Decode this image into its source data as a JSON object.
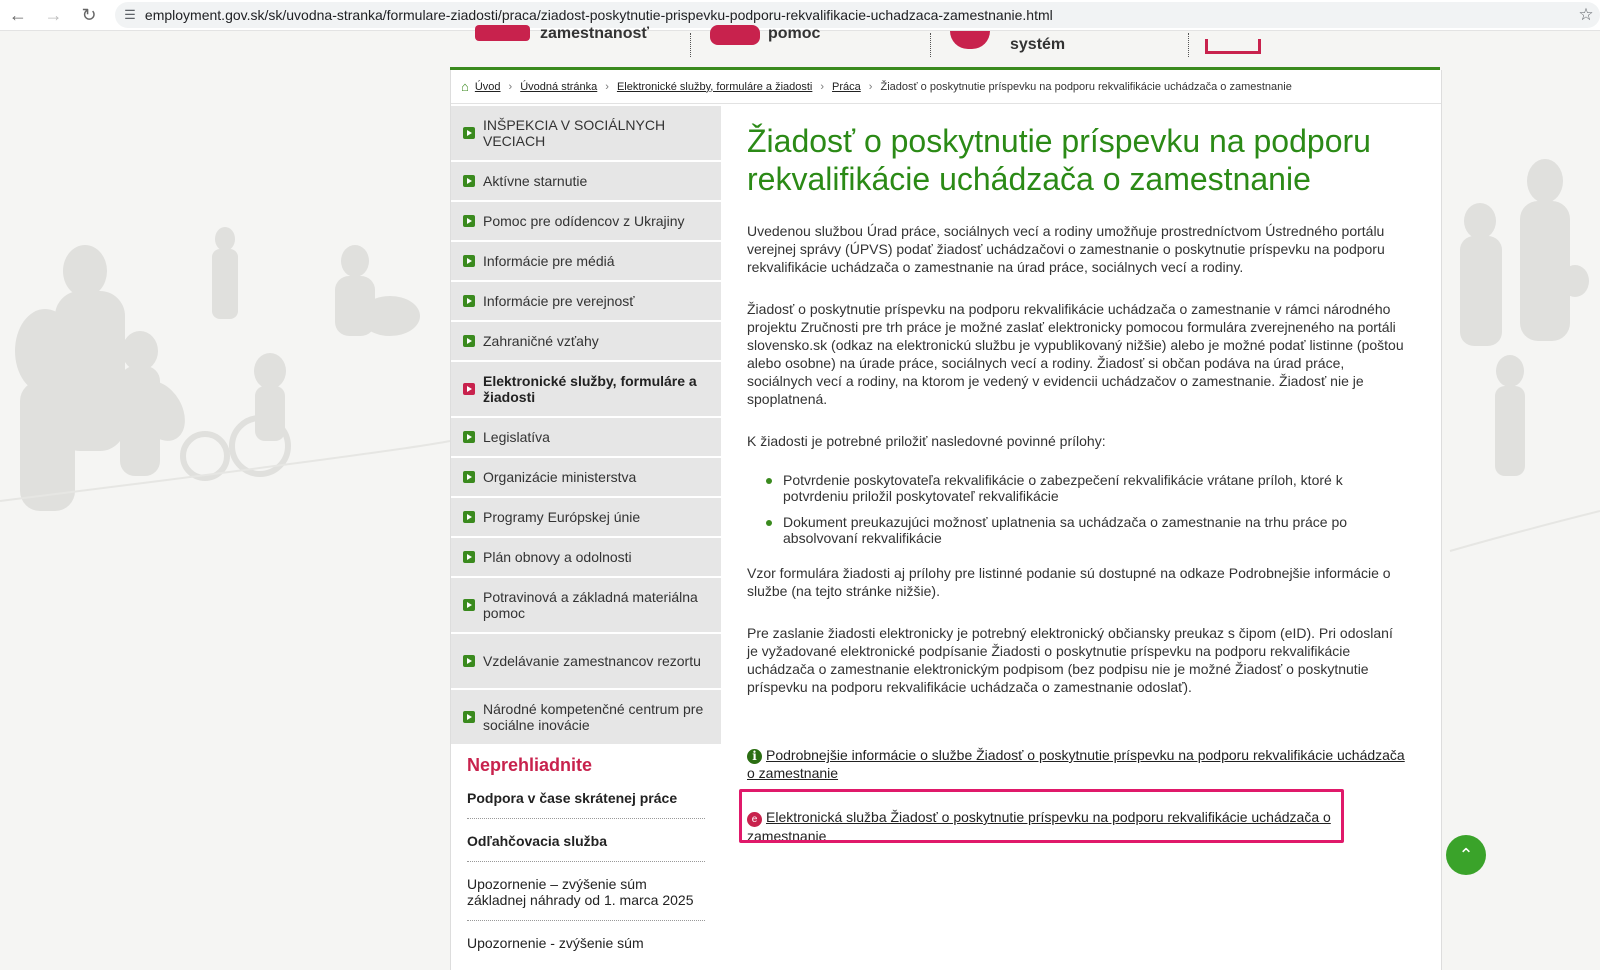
{
  "browser": {
    "url": "employment.gov.sk/sk/uvodna-stranka/formulare-ziadosti/praca/ziadost-poskytnutie-prispevku-podporu-rekvalifikacie-uchadzaca-zamestnanie.html"
  },
  "header": {
    "item1": "zamestnanosť",
    "item2": "pomoc",
    "item3": "systém"
  },
  "breadcrumb": {
    "items": [
      "Úvod",
      "Úvodná stránka",
      "Elektronické služby, formuláre a žiadosti",
      "Práca"
    ],
    "current": "Žiadosť o poskytnutie príspevku na podporu rekvalifikácie uchádzača o zamestnanie"
  },
  "sidebar": {
    "items": [
      {
        "label": "INŠPEKCIA V SOCIÁLNYCH VECIACH",
        "active": false
      },
      {
        "label": "Aktívne starnutie",
        "active": false
      },
      {
        "label": "Pomoc pre odídencov z Ukrajiny",
        "active": false
      },
      {
        "label": "Informácie pre médiá",
        "active": false
      },
      {
        "label": "Informácie pre verejnosť",
        "active": false
      },
      {
        "label": "Zahraničné vzťahy",
        "active": false
      },
      {
        "label": "Elektronické služby, formuláre a žiadosti",
        "active": true
      },
      {
        "label": "Legislatíva",
        "active": false
      },
      {
        "label": "Organizácie ministerstva",
        "active": false
      },
      {
        "label": "Programy Európskej únie",
        "active": false
      },
      {
        "label": "Plán obnovy a odolnosti",
        "active": false
      },
      {
        "label": "Potravinová a základná materiálna pomoc",
        "active": false
      },
      {
        "label": "Vzdelávanie zamestnancov rezortu",
        "active": false
      },
      {
        "label": "Národné kompetenčné centrum pre sociálne inovácie",
        "active": false
      }
    ]
  },
  "neprehliadnite": {
    "title": "Neprehliadnite",
    "items": [
      {
        "label": "Podpora v čase skrátenej práce",
        "bold": true
      },
      {
        "label": "Odľahčovacia služba",
        "bold": true
      },
      {
        "label": "Upozornenie – zvýšenie súm základnej náhrady od 1. marca 2025",
        "bold": false
      },
      {
        "label": "Upozornenie - zvýšenie súm",
        "bold": false
      }
    ]
  },
  "main": {
    "title": "Žiadosť o poskytnutie príspevku na podporu rekvalifikácie uchádzača o zamestnanie",
    "para1": "Uvedenou službou Úrad práce, sociálnych vecí a rodiny umožňuje prostredníctvom Ústredného portálu verejnej správy (ÚPVS) podať žiadosť uchádzačovi o zamestnanie o poskytnutie príspevku na podporu rekvalifikácie uchádzača o zamestnanie na úrad práce, sociálnych vecí a rodiny.",
    "para2": "Žiadosť o poskytnutie príspevku na podporu rekvalifikácie uchádzača o zamestnanie v rámci národného projektu Zručnosti pre trh práce je možné zaslať elektronicky pomocou formulára zverejneného na portáli slovensko.sk (odkaz na elektronickú službu je vypublikovaný nižšie) alebo je možné podať listinne (poštou alebo osobne) na úrade práce, sociálnych vecí a rodiny. Žiadosť si občan podáva na úrad práce, sociálnych vecí a rodiny, na ktorom je vedený v evidencii uchádzačov o zamestnanie. Žiadosť nie je spoplatnená.",
    "para3": "K žiadosti je potrebné priložiť nasledovné povinné prílohy:",
    "list": [
      "Potvrdenie poskytovateľa rekvalifikácie o zabezpečení rekvalifikácie vrátane príloh, ktoré k potvrdeniu priložil poskytovateľ rekvalifikácie",
      "Dokument preukazujúci možnosť uplatnenia sa uchádzača o zamestnanie na trhu práce po absolvovaní rekvalifikácie"
    ],
    "para4": "Vzor formulára žiadosti aj prílohy pre listinné podanie sú dostupné na odkaze Podrobnejšie informácie o službe (na tejto stránke nižšie).",
    "para5": "Pre zaslanie žiadosti elektronicky je potrebný elektronický občiansky preukaz s čipom (eID). Pri odoslaní je vyžadované elektronické podpísanie Žiadosti o poskytnutie príspevku na podporu rekvalifikácie uchádzača o zamestnanie elektronickým podpisom (bez podpisu nie je možné Žiadosť o poskytnutie príspevku na podporu rekvalifikácie uchádzača o zamestnanie odoslať).",
    "link_info": "Podrobnejšie informácie o službe Žiadosť o poskytnutie príspevku na podporu rekvalifikácie uchádzača o zamestnanie",
    "link_eservice": "Elektronická služba Žiadosť o poskytnutie príspevku na podporu rekvalifikácie uchádzača o zamestnanie"
  },
  "colors": {
    "green": "#2b8a16",
    "accent_red": "#c8224d",
    "highlight": "#e0196a"
  }
}
